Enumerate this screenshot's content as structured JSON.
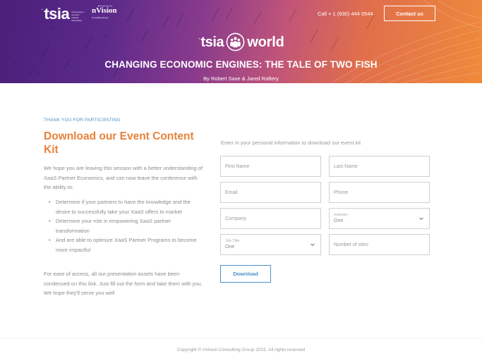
{
  "header": {
    "brand_logo_text": "tsia",
    "brand_tagline": "technology & services industry association",
    "partner_logo_text": "nVision",
    "partner_logo_subtext": "Consulting Group",
    "phone": "Call + 1 (630) 444 0544",
    "contact_label": "Contact us",
    "event_logo_left": "tsia",
    "event_logo_right": "world",
    "event_title": "CHANGING ECONOMIC ENGINES: THE TALE OF TWO FISH",
    "byline": "By Robert Saxe & Jared Raftery"
  },
  "content": {
    "eyebrow": "THANK YOU FOR PARTICIPATING",
    "title": "Download our Event Content Kit",
    "intro": "We hope you are leaving this session with a better understanding of XaaS Partner Economics, and can now leave the conference with the ability to:",
    "bullets": [
      "Determine if your partners to have the knowledge and the desire to successfully take your XaaS offers to market",
      "Determine your role in empowering XaaS partner transformation",
      "And are able to optimize XaaS Partner Programs to become more impactful"
    ],
    "outro": "For ease of access, all our presentation assets have been condensed on this link. Just fill out the form and take them with you. We hope they'll serve you well"
  },
  "form": {
    "intro": "Enter in your personal information to download our event kit",
    "first_name_placeholder": "First Name",
    "last_name_placeholder": "Last Name",
    "email_placeholder": "Email",
    "phone_placeholder": "Phone",
    "company_placeholder": "Company",
    "industry_label": "Industry",
    "industry_value": "One",
    "job_title_label": "Job Title",
    "job_title_value": "One",
    "sites_placeholder": "Number of sites",
    "download_label": "Download"
  },
  "footer": {
    "copyright": "Copyright © nVision Consulting Group 2022. All rights reserved"
  },
  "colors": {
    "accent_orange": "#e8823a",
    "accent_blue": "#4a90c9",
    "hero_purple": "#4b1f7a",
    "hero_orange": "#ef8a3a"
  }
}
